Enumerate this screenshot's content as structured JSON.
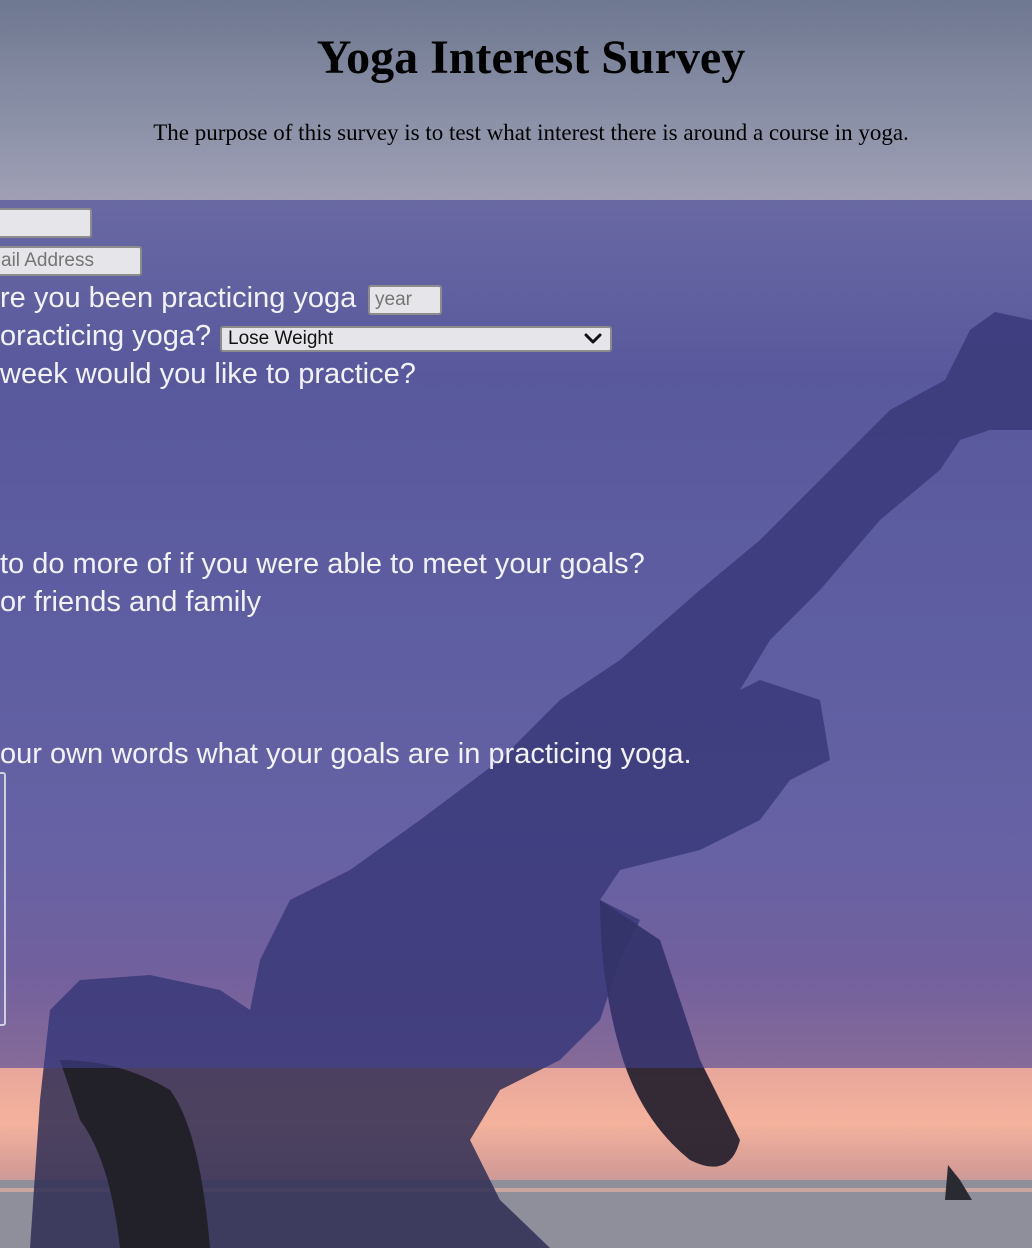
{
  "title": "Yoga Interest Survey",
  "description": "The purpose of this survey is to test what interest there is around a course in yoga.",
  "form": {
    "name_placeholder": "",
    "email_placeholder": "ail Address",
    "years_label": "re you been practicing yoga",
    "years_placeholder": "year",
    "goal_label": "oracticing yoga?",
    "goal_selected": "Lose Weight",
    "days_label": "week would you like to practice?",
    "more_of_label": "to do more of if you were able to meet your goals?",
    "friends_label": "or friends and family",
    "own_words_label": "our own words what your goals are in practicing yoga."
  },
  "colors": {
    "panel": "#5f5fa0",
    "label_text": "#f2f2f6",
    "silhouette": "#3b3a72"
  }
}
